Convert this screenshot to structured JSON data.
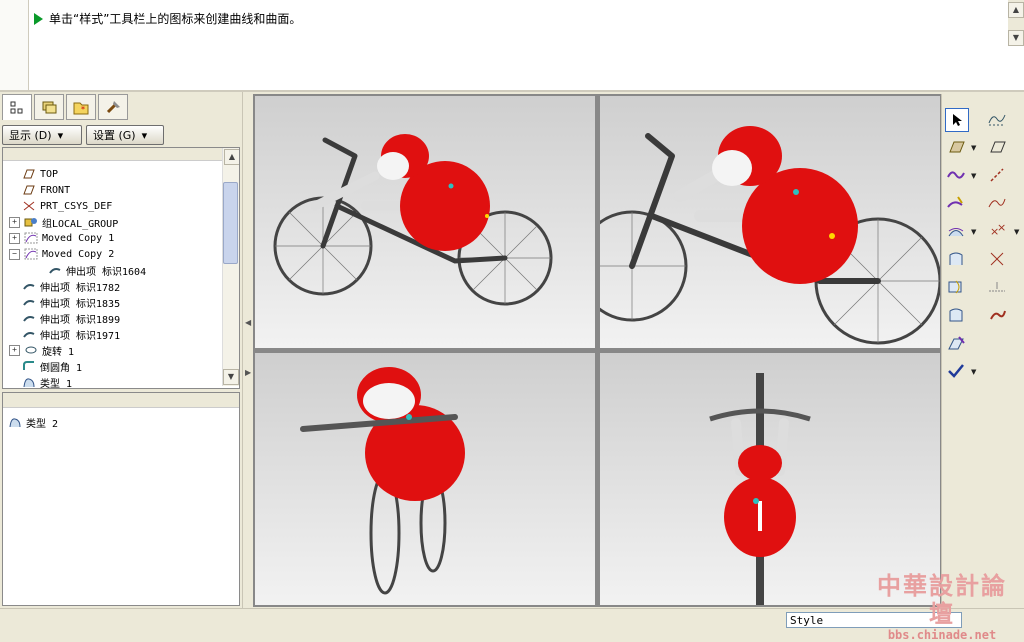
{
  "message": {
    "text": "单击“样式”工具栏上的图标来创建曲线和曲面。"
  },
  "tabs": [
    "model-tree-icon",
    "layers-icon",
    "folder-star-icon",
    "tools-icon"
  ],
  "buttons": {
    "display": "显示 (D)",
    "settings": "设置 (G)"
  },
  "tree": [
    {
      "label": "TOP",
      "icon": "datum-plane-icon",
      "expand": ""
    },
    {
      "label": "FRONT",
      "icon": "datum-plane-icon",
      "expand": ""
    },
    {
      "label": "PRT_CSYS_DEF",
      "icon": "csys-icon",
      "expand": ""
    },
    {
      "label": "组LOCAL_GROUP",
      "icon": "group-icon",
      "expand": "+"
    },
    {
      "label": "Moved Copy 1",
      "icon": "copy-icon",
      "expand": "+"
    },
    {
      "label": "Moved Copy 2",
      "icon": "copy-icon",
      "expand": "-"
    },
    {
      "label": "伸出项 标识1604",
      "icon": "protrusion-icon",
      "expand": "",
      "indent": true
    },
    {
      "label": "伸出项 标识1782",
      "icon": "protrusion-icon",
      "expand": ""
    },
    {
      "label": "伸出项 标识1835",
      "icon": "protrusion-icon",
      "expand": ""
    },
    {
      "label": "伸出项 标识1899",
      "icon": "protrusion-icon",
      "expand": ""
    },
    {
      "label": "伸出项 标识1971",
      "icon": "protrusion-icon",
      "expand": ""
    },
    {
      "label": "旋转 1",
      "icon": "revolve-icon",
      "expand": "+"
    },
    {
      "label": "倒圆角 1",
      "icon": "round-icon",
      "expand": ""
    },
    {
      "label": "类型 1",
      "icon": "style-icon",
      "expand": ""
    }
  ],
  "lower_panel": {
    "item": "类型 2"
  },
  "status": {
    "style_select": "Style"
  },
  "watermark": {
    "line1": "中華設計論壇",
    "line2": "bbs.chinade.net"
  },
  "colors": {
    "body_red": "#e01010",
    "frame_gray": "#444444",
    "background": "#ece9d8"
  }
}
